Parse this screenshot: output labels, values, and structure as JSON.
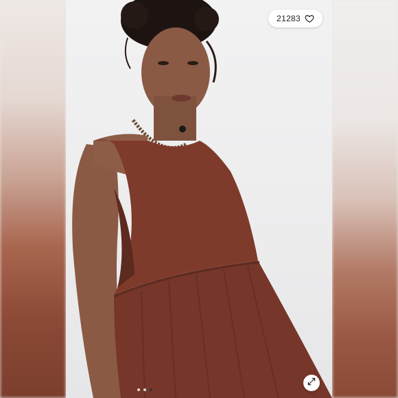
{
  "listing": {
    "likes_count": "21283"
  },
  "gallery": {
    "total_images": 3,
    "active_index": 2
  },
  "icons": {
    "like": "heart-icon",
    "expand": "expand-arrows-icon"
  },
  "colors": {
    "dress": "#7e3a2a",
    "pill_bg": "#ffffff"
  }
}
